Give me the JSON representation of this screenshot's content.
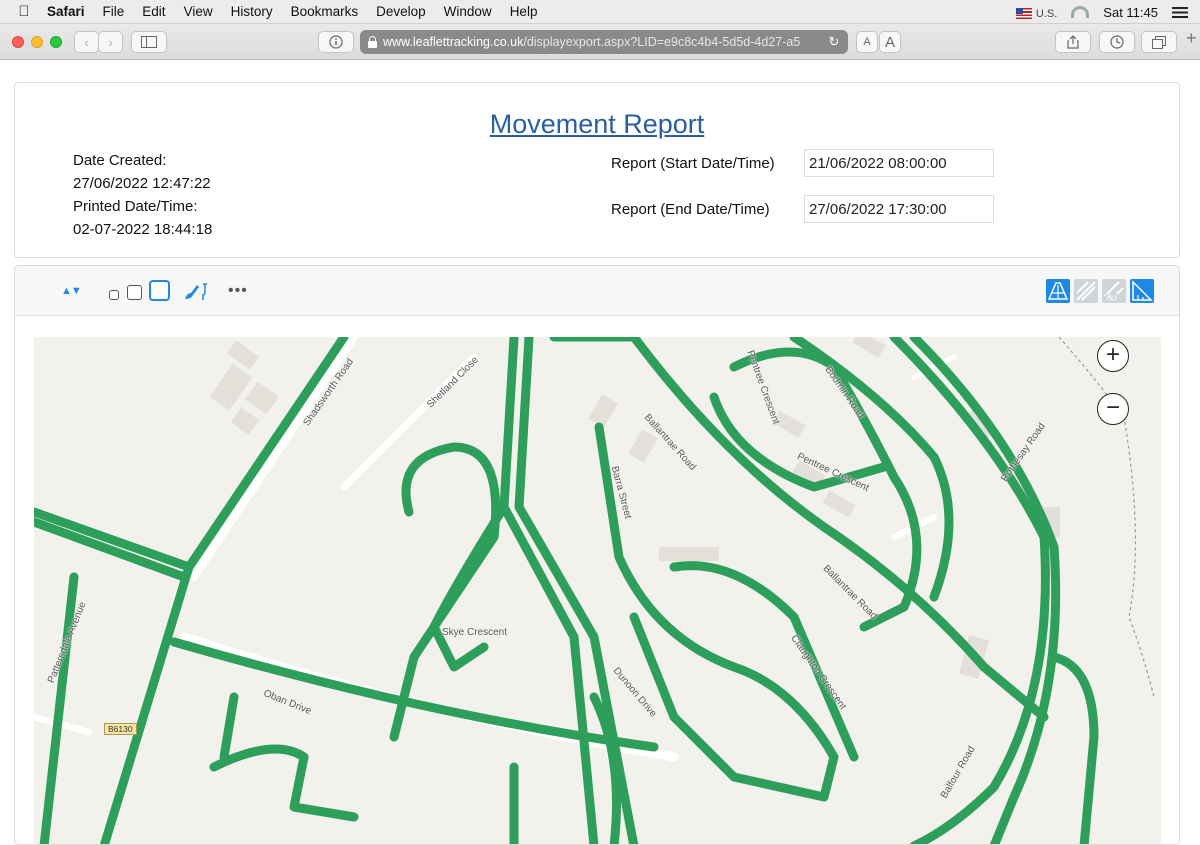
{
  "menubar": {
    "items": [
      "Safari",
      "File",
      "Edit",
      "View",
      "History",
      "Bookmarks",
      "Develop",
      "Window",
      "Help"
    ],
    "input_source": "U.S.",
    "clock": "Sat 11:45"
  },
  "browser": {
    "url_domain": "www.leaflettracking.co.uk",
    "url_path": "/displayexport.aspx?LID=e9c8c4b4-5d5d-4d27-a5",
    "reader_small": "A",
    "reader_large": "A"
  },
  "report": {
    "title": "Movement Report",
    "date_created_label": "Date Created:",
    "date_created_value": "27/06/2022 12:47:22",
    "printed_label": "Printed Date/Time:",
    "printed_value": "02-07-2022 18:44:18",
    "start_label": "Report (Start Date/Time)",
    "start_value": "21/06/2022 08:00:00",
    "end_label": "Report (End Date/Time)",
    "end_value": "27/06/2022 17:30:00"
  },
  "map_toolbar": {
    "icons": [
      "sort-arrows-icon",
      "small-square-icon",
      "medium-square-icon",
      "large-square-icon",
      "brush-icon",
      "more-icon",
      "satellite-layer-icon",
      "roads-layer-icon",
      "labels-layer-icon",
      "measure-layer-icon"
    ]
  },
  "map": {
    "zoom_in": "+",
    "zoom_out": "−",
    "route_color": "#2e9e5b",
    "road_badge": "B6130",
    "street_labels": [
      "Shadsworth Road",
      "Shetland Close",
      "Pentree Crescent",
      "Ballantrae Road",
      "Barra Street",
      "Bodmin Road",
      "Rothesay Road",
      "Skye Crescent",
      "Oban Drive",
      "Dunoon Drive",
      "Pattersdale Avenue",
      "Ballantrae Road",
      "Claughton Crescent",
      "Pentree Crescent",
      "Balfour Road"
    ]
  }
}
